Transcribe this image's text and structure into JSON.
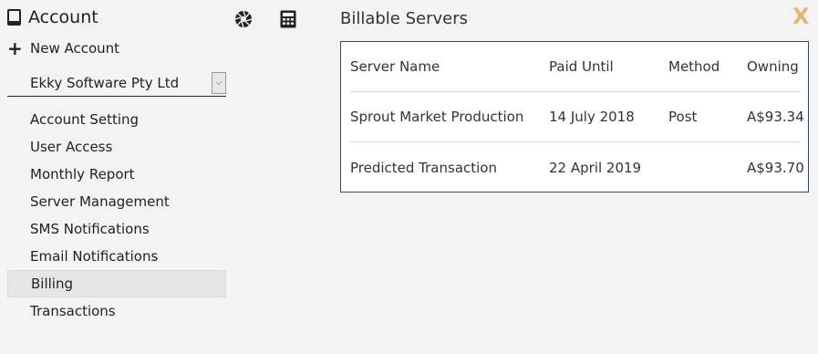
{
  "sidebar": {
    "title": "Account",
    "new_account_label": "New Account",
    "account_select_value": "Ekky Software Pty Ltd",
    "items": [
      {
        "label": "Account Setting"
      },
      {
        "label": "User Access"
      },
      {
        "label": "Monthly Report"
      },
      {
        "label": "Server Management"
      },
      {
        "label": "SMS Notifications"
      },
      {
        "label": "Email Notifications"
      },
      {
        "label": "Billing"
      },
      {
        "label": "Transactions"
      }
    ],
    "active_item": "Billing"
  },
  "toolbar": {
    "icons": [
      "aperture-icon",
      "calculator-icon"
    ]
  },
  "main": {
    "title": "Billable Servers",
    "close_label": "X",
    "table": {
      "headers": [
        "Server Name",
        "Paid Until",
        "Method",
        "Owning"
      ],
      "rows": [
        [
          "Sprout Market Production",
          "14 July 2018",
          "Post",
          "A$93.34"
        ],
        [
          "Predicted Transaction",
          "22 April 2019",
          "",
          "A$93.70"
        ]
      ]
    }
  },
  "colors": {
    "background": "#f3f3f3",
    "close_accent": "#e8b271",
    "table_border": "#2c4a62",
    "active_item_bg": "#e6e6e6"
  }
}
